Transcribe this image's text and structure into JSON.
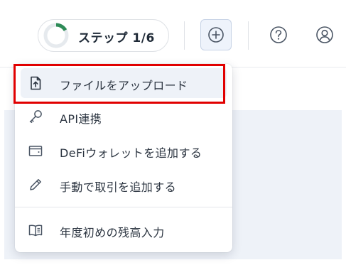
{
  "colors": {
    "accent": "#2e8b57",
    "highlight_border": "#e10000",
    "text": "#2b3440"
  },
  "header": {
    "step_label": "ステップ 1/6",
    "step_progress": 0.1667,
    "add_icon": "plus-circle-icon",
    "help_icon": "question-circle-icon",
    "user_icon": "user-circle-icon"
  },
  "menu": {
    "items": [
      {
        "label": "ファイルをアップロード",
        "icon": "file-upload-icon",
        "active": true
      },
      {
        "label": "API連携",
        "icon": "key-icon"
      },
      {
        "label": "DeFiウォレットを追加する",
        "icon": "wallet-icon"
      },
      {
        "label": "手動で取引を追加する",
        "icon": "pencil-icon"
      },
      {
        "label": "年度初めの残高入力",
        "icon": "book-icon"
      }
    ]
  }
}
